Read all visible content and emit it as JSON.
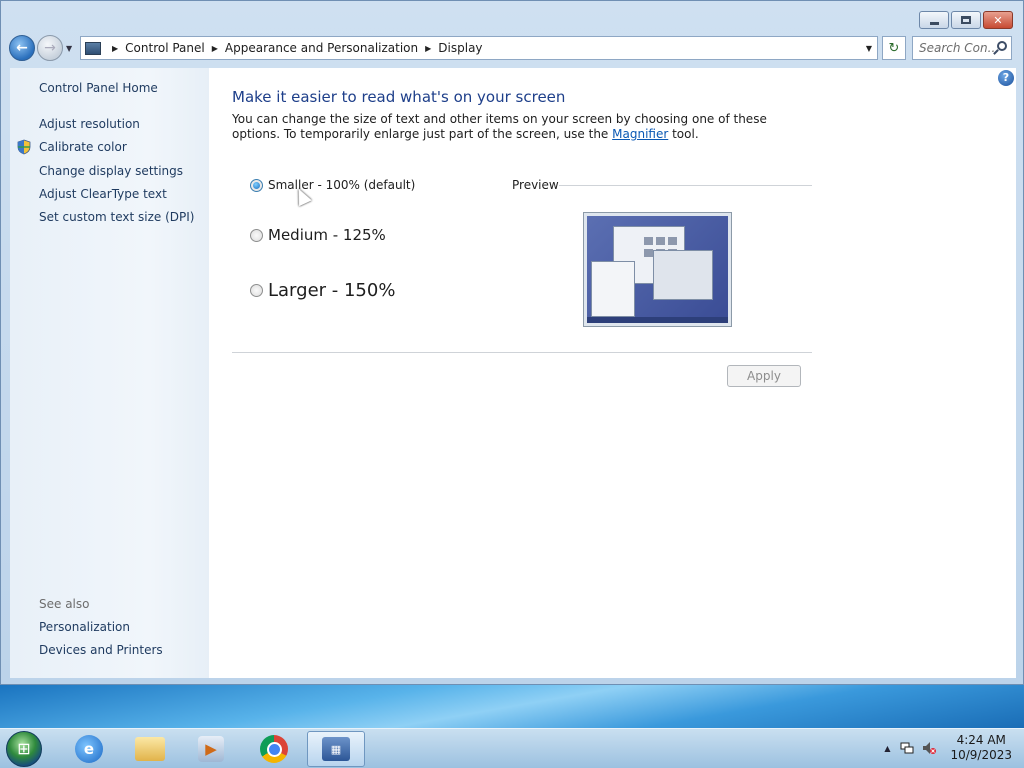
{
  "window": {
    "caption": {
      "minimize": "",
      "maximize": "",
      "close": "✕"
    }
  },
  "nav": {
    "back_symbol": "←",
    "forward_symbol": "→",
    "recent_symbol": "▼",
    "breadcrumb": [
      "Control Panel",
      "Appearance and Personalization",
      "Display"
    ],
    "separator": "▶",
    "dropdown_symbol": "▼",
    "refresh_symbol": "↻",
    "search_placeholder": "Search Con..."
  },
  "sidebar": {
    "home": "Control Panel Home",
    "links": [
      "Adjust resolution",
      "Calibrate color",
      "Change display settings",
      "Adjust ClearType text",
      "Set custom text size (DPI)"
    ],
    "see_also_title": "See also",
    "see_also": [
      "Personalization",
      "Devices and Printers"
    ]
  },
  "main": {
    "title": "Make it easier to read what's on your screen",
    "desc_before": "You can change the size of text and other items on your screen by choosing one of these options. To temporarily enlarge just part of the screen, use the ",
    "desc_link": "Magnifier",
    "desc_after": " tool.",
    "options": [
      {
        "label": "Smaller - 100% (default)",
        "checked": true
      },
      {
        "label": "Medium - 125%",
        "checked": false
      },
      {
        "label": "Larger - 150%",
        "checked": false
      }
    ],
    "preview_label": "Preview",
    "apply_label": "Apply",
    "help_symbol": "?"
  },
  "taskbar": {
    "start_symbol": "⊞",
    "apps": [
      {
        "name": "ie",
        "glyph": "e"
      },
      {
        "name": "explorer",
        "glyph": ""
      },
      {
        "name": "media",
        "glyph": "▶"
      },
      {
        "name": "chrome",
        "glyph": ""
      },
      {
        "name": "control-panel",
        "glyph": "▦",
        "active": true
      }
    ],
    "tray_arrow": "▲",
    "time": "4:24 AM",
    "date": "10/9/2023"
  },
  "colors": {
    "title_blue": "#1e3f8a",
    "link_blue": "#0a58b4",
    "sidebar_link": "#1e3a5f"
  }
}
